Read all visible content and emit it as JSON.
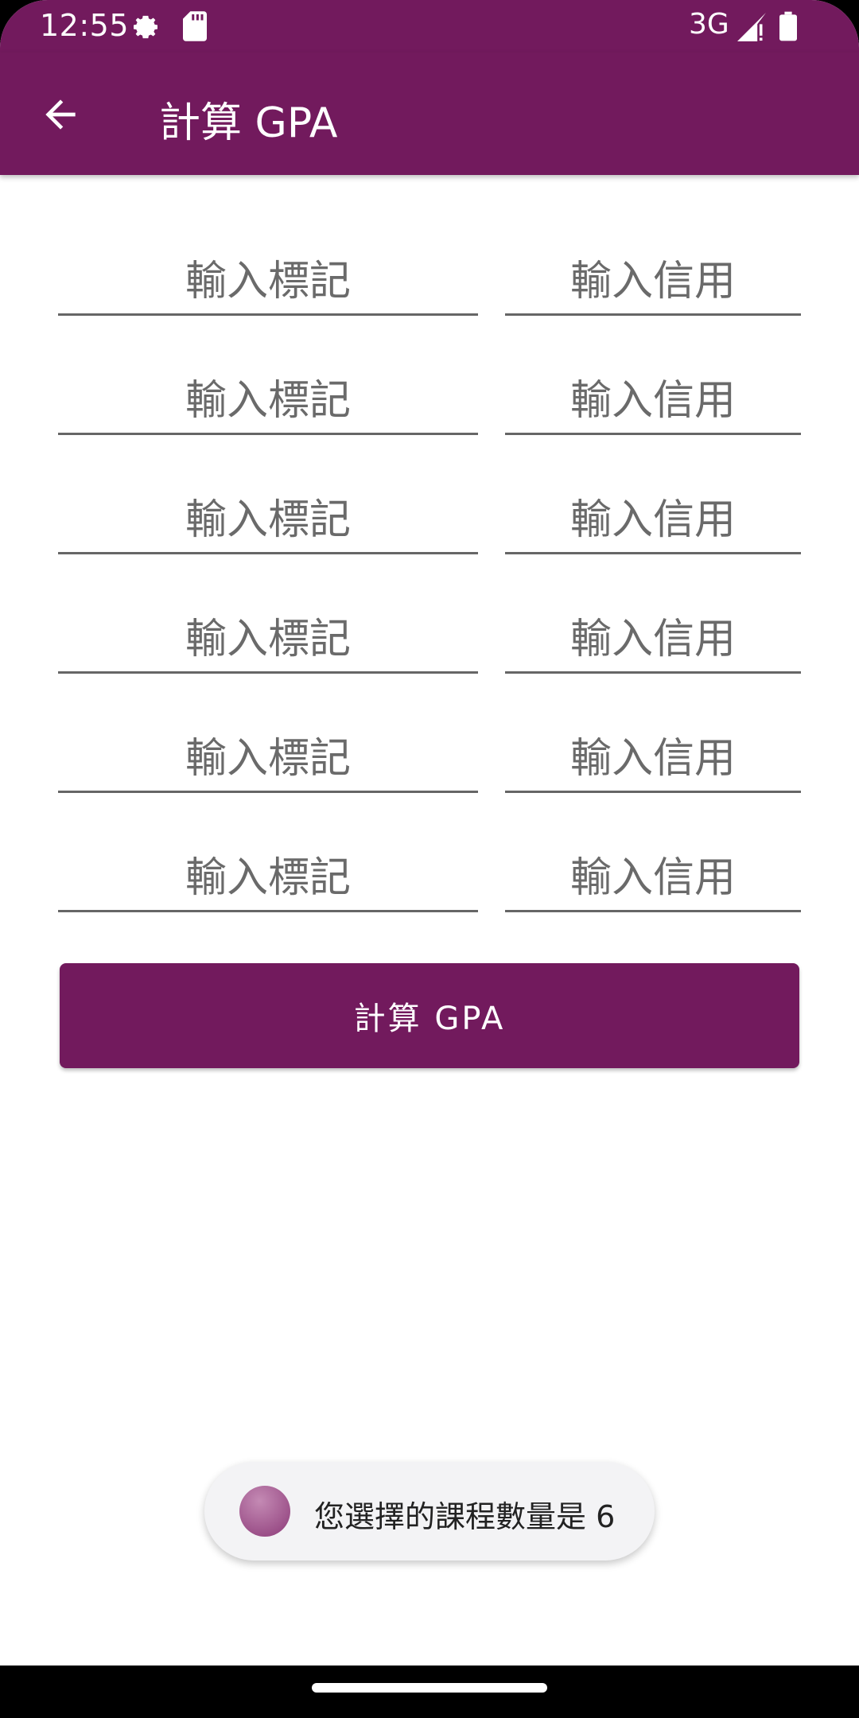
{
  "status_bar": {
    "time": "12:55",
    "network": "3G",
    "icons": [
      "gear-icon",
      "sd-card-icon",
      "signal-icon",
      "battery-icon"
    ]
  },
  "app_bar": {
    "title": "計算 GPA",
    "back_icon": "arrow-back-icon"
  },
  "rows": [
    {
      "mark_placeholder": "輸入標記",
      "credit_placeholder": "輸入信用"
    },
    {
      "mark_placeholder": "輸入標記",
      "credit_placeholder": "輸入信用"
    },
    {
      "mark_placeholder": "輸入標記",
      "credit_placeholder": "輸入信用"
    },
    {
      "mark_placeholder": "輸入標記",
      "credit_placeholder": "輸入信用"
    },
    {
      "mark_placeholder": "輸入標記",
      "credit_placeholder": "輸入信用"
    },
    {
      "mark_placeholder": "輸入標記",
      "credit_placeholder": "輸入信用"
    }
  ],
  "calculate_button": {
    "label": "計算 GPA"
  },
  "toast": {
    "text": "您選擇的課程數量是 6"
  },
  "colors": {
    "primary": "#721a5d",
    "background": "#ffffff",
    "underline": "#666666"
  }
}
